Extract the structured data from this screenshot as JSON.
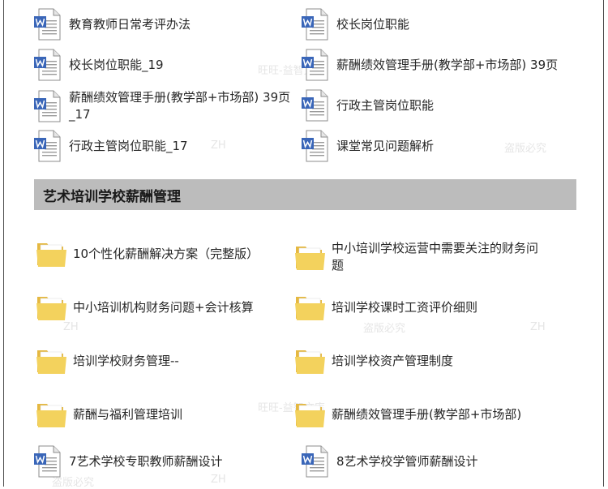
{
  "document_items": [
    {
      "label": "教育教师日常考评办法"
    },
    {
      "label": "校长岗位职能"
    },
    {
      "label": "校长岗位职能_19"
    },
    {
      "label": "薪酬绩效管理手册(教学部+市场部) 39页"
    },
    {
      "label": "薪酬绩效管理手册(教学部+市场部) 39页_17"
    },
    {
      "label": "行政主管岗位职能"
    },
    {
      "label": "行政主管岗位职能_17"
    },
    {
      "label": "课堂常见问题解析"
    }
  ],
  "section": {
    "title": "艺术培训学校薪酬管理"
  },
  "folder_items": [
    {
      "label": "10个性化薪酬解决方案（完整版）"
    },
    {
      "label": "中小培训学校运营中需要关注的财务问题"
    },
    {
      "label": "中小培训机构财务问题+会计核算"
    },
    {
      "label": "培训学校课时工资评价细则"
    },
    {
      "label": "培训学校财务管理--"
    },
    {
      "label": "培训学校资产管理制度"
    },
    {
      "label": "薪酬与福利管理培训"
    },
    {
      "label": "薪酬绩效管理手册(教学部+市场部)"
    }
  ],
  "bottom_document_items": [
    {
      "label": "7艺术学校专职教师薪酬设计"
    },
    {
      "label": "8艺术学校学管师薪酬设计"
    }
  ],
  "watermarks": [
    "旺旺-益智文库",
    "ZH",
    "盗版必究",
    "ZH",
    "盗版必究",
    "ZH",
    "旺旺-益智文库",
    "盗版必究",
    "ZH"
  ],
  "colors": {
    "section_bg": "#bcbcbc",
    "folder": "#f3d25d",
    "doc_blue": "#3a66b8"
  }
}
